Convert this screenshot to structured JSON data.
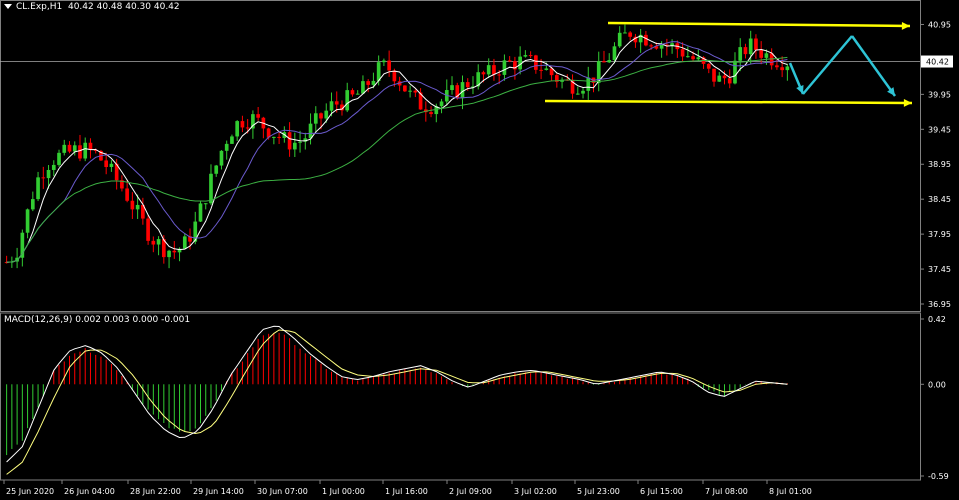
{
  "header": {
    "symbol": "CL.Exp,H1",
    "ohlc": "40.42 40.48 40.30 40.42"
  },
  "macd_header": "MACD(12,26,9) 0.002 0.003 0.000 -0.001",
  "colors": {
    "background": "#000000",
    "grid": "#808080",
    "bull_candle": "#32CD32",
    "bear_candle": "#FF0000",
    "fast_ma": "#FFFFFF",
    "mid_ma": "#6A5ACD",
    "slow_ma": "#3CB043",
    "channel_line": "#FFFF00",
    "projection": "#2EC4D6",
    "macd_line": "#FFFFFF",
    "signal_line": "#FFFF80"
  },
  "chart_data": [
    {
      "type": "candlestick",
      "title": "CL.Exp,H1",
      "yticks": [
        "40.95",
        "40.42",
        "39.95",
        "39.45",
        "38.95",
        "38.45",
        "37.95",
        "37.45",
        "36.95"
      ],
      "current_price": "40.42",
      "ylim": [
        36.85,
        41.1
      ],
      "xticks": [
        "25 Jun 2020",
        "26 Jun 04:00",
        "28 Jun 22:00",
        "29 Jun 14:00",
        "30 Jun 07:00",
        "1 Jul 00:00",
        "1 Jul 16:00",
        "2 Jul 09:00",
        "3 Jul 02:00",
        "5 Jul 23:00",
        "6 Jul 15:00",
        "7 Jul 08:00",
        "8 Jul 01:00"
      ],
      "close_path": [
        37.55,
        37.7,
        38.2,
        38.7,
        38.95,
        39.05,
        39.1,
        39.15,
        39.15,
        39.1,
        38.95,
        38.75,
        38.55,
        38.3,
        38.05,
        37.85,
        37.75,
        37.7,
        37.8,
        38.05,
        38.45,
        38.85,
        39.25,
        39.5,
        39.6,
        39.6,
        39.5,
        39.4,
        39.3,
        39.25,
        39.3,
        39.5,
        39.65,
        39.8,
        39.85,
        39.9,
        40.0,
        40.2,
        40.35,
        40.3,
        40.1,
        39.9,
        39.8,
        39.8,
        39.85,
        39.95,
        40.05,
        40.15,
        40.2,
        40.25,
        40.35,
        40.4,
        40.42,
        40.4,
        40.35,
        40.25,
        40.15,
        40.1,
        40.1,
        40.15,
        40.3,
        40.5,
        40.7,
        40.85,
        40.8,
        40.75,
        40.7,
        40.65,
        40.6,
        40.5,
        40.4,
        40.25,
        40.15,
        40.2,
        40.45,
        40.65,
        40.6,
        40.5,
        40.45,
        40.42
      ]
    },
    {
      "type": "histogram",
      "title": "MACD(12,26,9) 0.002 0.003 0.000 -0.001",
      "yticks": [
        "0.42",
        "0.00",
        "-0.59"
      ],
      "ylim": [
        -0.59,
        0.42
      ],
      "macd_path": [
        -0.5,
        -0.4,
        -0.15,
        0.1,
        0.22,
        0.25,
        0.2,
        0.1,
        -0.05,
        -0.2,
        -0.3,
        -0.35,
        -0.3,
        -0.15,
        0.05,
        0.2,
        0.35,
        0.38,
        0.3,
        0.2,
        0.12,
        0.05,
        0.03,
        0.05,
        0.08,
        0.1,
        0.12,
        0.08,
        0.02,
        -0.02,
        0.02,
        0.06,
        0.08,
        0.09,
        0.07,
        0.05,
        0.03,
        0.0,
        0.02,
        0.04,
        0.06,
        0.08,
        0.06,
        0.02,
        -0.05,
        -0.08,
        -0.03,
        0.02,
        0.01,
        0.0
      ],
      "signal_path": [
        -0.58,
        -0.5,
        -0.3,
        -0.08,
        0.12,
        0.22,
        0.22,
        0.16,
        0.05,
        -0.1,
        -0.22,
        -0.3,
        -0.32,
        -0.26,
        -0.1,
        0.08,
        0.25,
        0.35,
        0.34,
        0.26,
        0.18,
        0.1,
        0.06,
        0.05,
        0.06,
        0.08,
        0.1,
        0.09,
        0.05,
        0.01,
        0.01,
        0.04,
        0.06,
        0.08,
        0.08,
        0.06,
        0.04,
        0.02,
        0.02,
        0.03,
        0.05,
        0.07,
        0.07,
        0.04,
        -0.01,
        -0.05,
        -0.04,
        0.0,
        0.01,
        0.0
      ]
    }
  ]
}
